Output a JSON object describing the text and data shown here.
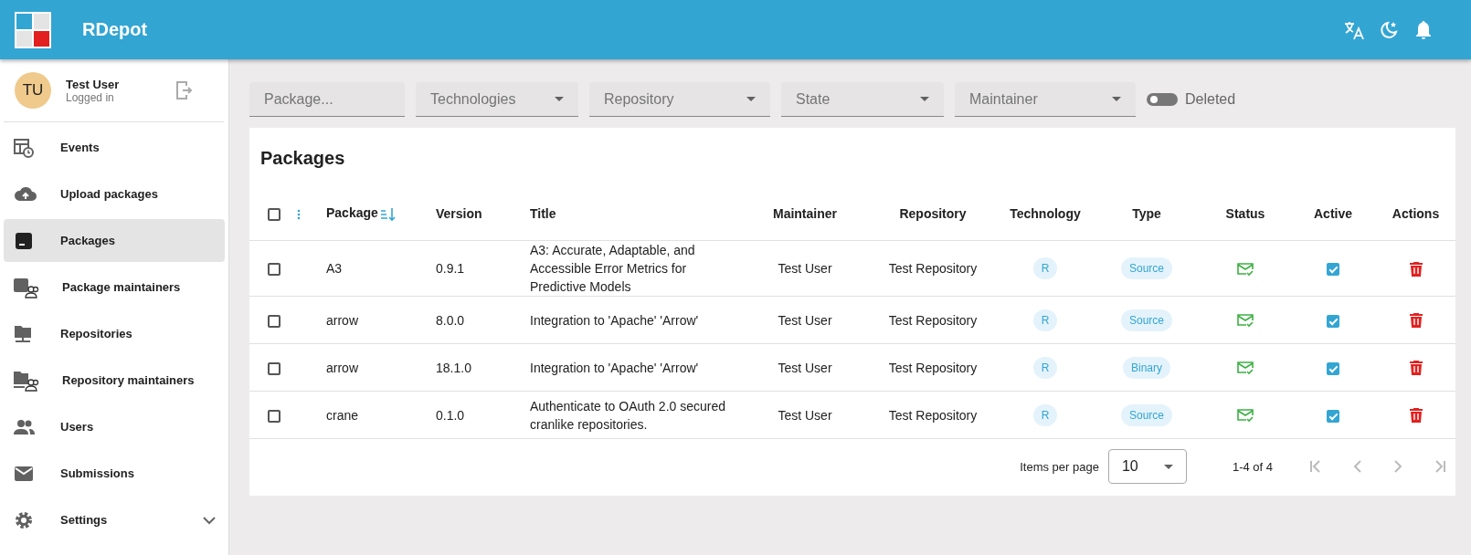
{
  "app_bar": {
    "title": "RDepot"
  },
  "user": {
    "initials": "TU",
    "name": "Test User",
    "status": "Logged in"
  },
  "sidebar": {
    "items": [
      {
        "label": "Events",
        "selected": false
      },
      {
        "label": "Upload packages",
        "selected": false
      },
      {
        "label": "Packages",
        "selected": true
      },
      {
        "label": "Package maintainers",
        "selected": false
      },
      {
        "label": "Repositories",
        "selected": false
      },
      {
        "label": "Repository maintainers",
        "selected": false
      },
      {
        "label": "Users",
        "selected": false
      },
      {
        "label": "Submissions",
        "selected": false
      },
      {
        "label": "Settings",
        "selected": false,
        "expanded": false
      }
    ]
  },
  "filters": [
    {
      "kind": "text",
      "placeholder": "Package..."
    },
    {
      "kind": "select",
      "placeholder": "Technologies"
    },
    {
      "kind": "select",
      "placeholder": "Repository"
    },
    {
      "kind": "select",
      "placeholder": "State"
    },
    {
      "kind": "select",
      "placeholder": "Maintainer"
    }
  ],
  "deleted_toggle": {
    "label": "Deleted",
    "on": false
  },
  "table": {
    "title": "Packages",
    "all_checked": false,
    "columns": [
      "Package",
      "Version",
      "Title",
      "Maintainer",
      "Repository",
      "Technology",
      "Type",
      "Status",
      "Active",
      "Actions"
    ],
    "rows": [
      {
        "checked": false,
        "package": "A3",
        "version": "0.9.1",
        "title": "A3: Accurate, Adaptable, and Accessible Error Metrics for Predictive Models",
        "maintainer": "Test User",
        "repository": "Test Repository",
        "technology": "R",
        "type": "Source",
        "submission_accepted": true,
        "active": true
      },
      {
        "checked": false,
        "package": "arrow",
        "version": "8.0.0",
        "title": "Integration to 'Apache' 'Arrow'",
        "maintainer": "Test User",
        "repository": "Test Repository",
        "technology": "R",
        "type": "Source",
        "submission_accepted": true,
        "active": true
      },
      {
        "checked": false,
        "package": "arrow",
        "version": "18.1.0",
        "title": "Integration to 'Apache' 'Arrow'",
        "maintainer": "Test User",
        "repository": "Test Repository",
        "technology": "R",
        "type": "Binary",
        "submission_accepted": true,
        "active": true
      },
      {
        "checked": false,
        "package": "crane",
        "version": "0.1.0",
        "title": "Authenticate to OAuth 2.0 secured cranlike repositories.",
        "maintainer": "Test User",
        "repository": "Test Repository",
        "technology": "R",
        "type": "Source",
        "submission_accepted": true,
        "active": true
      }
    ]
  },
  "pagination": {
    "label": "Items per page",
    "page_size": "10",
    "range": "1-4 of 4"
  }
}
